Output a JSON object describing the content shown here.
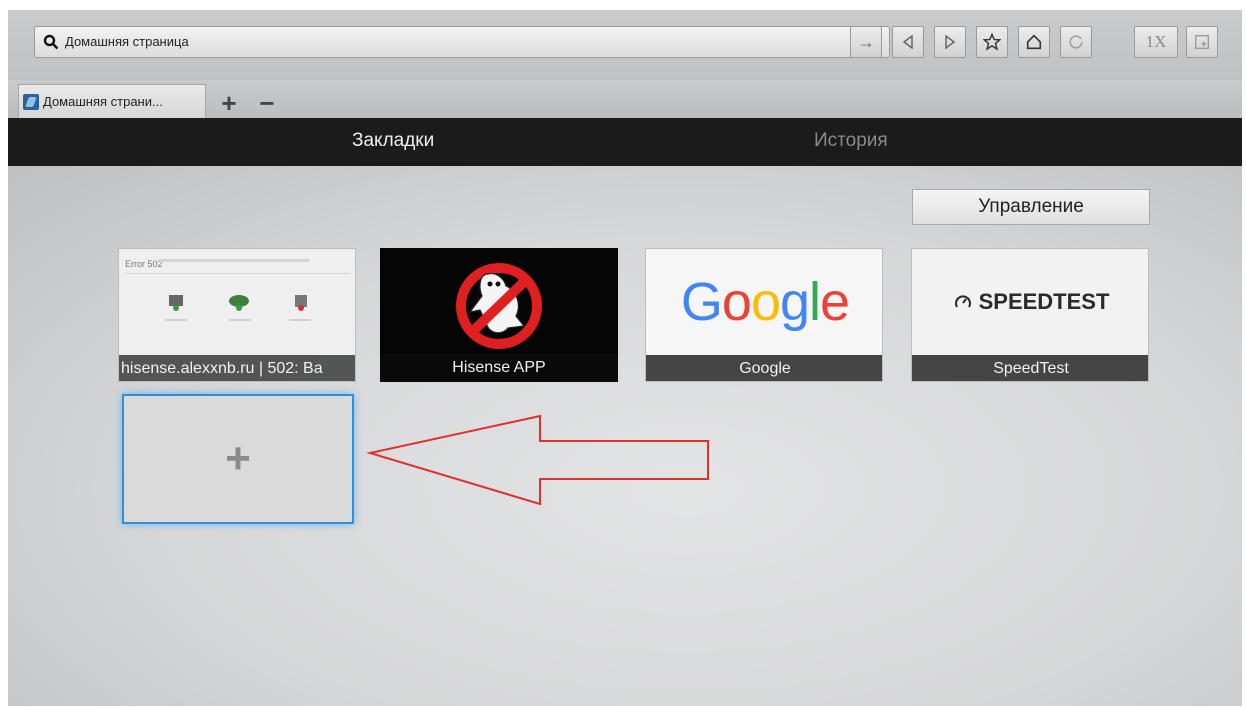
{
  "address_bar": {
    "url_text": "Домашняя страница"
  },
  "toolbar": {
    "zoom_label": "1X"
  },
  "tabs": [
    {
      "label": "Домашняя страни..."
    }
  ],
  "tab_controls": {
    "add": "+",
    "remove": "−"
  },
  "categories": [
    {
      "label": "Закладки",
      "active": true
    },
    {
      "label": "История",
      "active": false
    }
  ],
  "manage_button": {
    "label": "Управление"
  },
  "bookmarks": [
    {
      "caption": "hisense.alexxnb.ru | 502: Ba",
      "thumb_title": "Error 502"
    },
    {
      "caption": "Hisense APP"
    },
    {
      "caption": "Google",
      "logo_text": "Google"
    },
    {
      "caption": "SpeedTest",
      "logo_text": "SPEEDTEST"
    }
  ],
  "add_bookmark": {
    "symbol": "+"
  },
  "colors": {
    "accent_blue": "#2f8fd8",
    "arrow_red": "#e0302c",
    "google_blue": "#4285f4",
    "google_red": "#ea4335",
    "google_yellow": "#fbbc05",
    "google_green": "#34a853"
  }
}
